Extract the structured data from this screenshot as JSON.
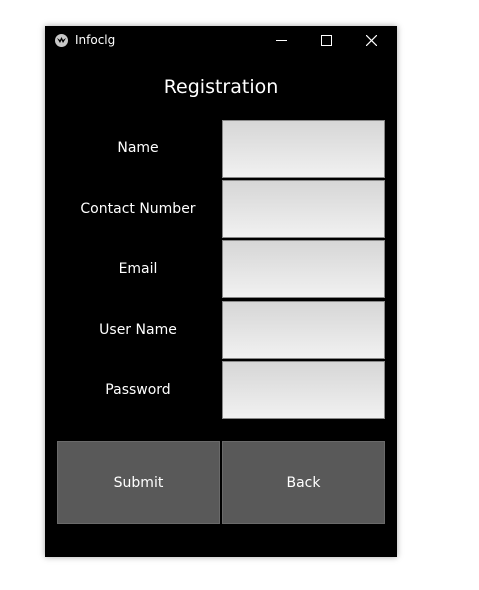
{
  "window": {
    "title": "Infoclg"
  },
  "form": {
    "heading": "Registration",
    "fields": [
      {
        "label": "Name",
        "value": ""
      },
      {
        "label": "Contact Number",
        "value": ""
      },
      {
        "label": "Email",
        "value": ""
      },
      {
        "label": "User Name",
        "value": ""
      },
      {
        "label": "Password",
        "value": ""
      }
    ],
    "submit_label": "Submit",
    "back_label": "Back"
  },
  "icons": {
    "app": "kivy-logo-icon",
    "minimize": "minimize-icon",
    "maximize": "maximize-icon",
    "close": "close-icon"
  },
  "colors": {
    "window_background": "#000000",
    "button_background": "#595959",
    "input_background": "#e6e6e6",
    "text": "#ffffff"
  }
}
